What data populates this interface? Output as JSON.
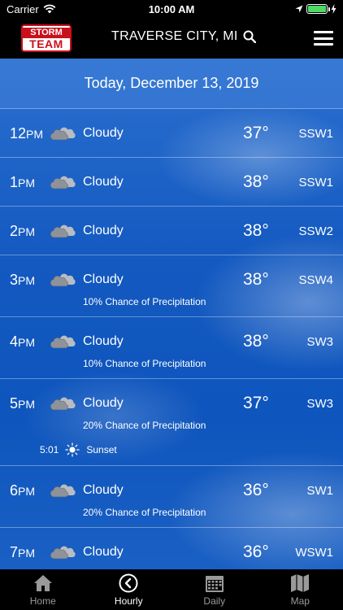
{
  "status": {
    "carrier": "Carrier",
    "time": "10:00 AM"
  },
  "header": {
    "logo_line1": "STORM",
    "logo_line2": "TEAM",
    "location": "TRAVERSE CITY, MI"
  },
  "date": "Today, December 13, 2019",
  "rows": [
    {
      "hour": "12",
      "ampm": "PM",
      "condition": "Cloudy",
      "temp": "37°",
      "wind": "SSW1"
    },
    {
      "hour": "1",
      "ampm": "PM",
      "condition": "Cloudy",
      "temp": "38°",
      "wind": "SSW1"
    },
    {
      "hour": "2",
      "ampm": "PM",
      "condition": "Cloudy",
      "temp": "38°",
      "wind": "SSW2"
    },
    {
      "hour": "3",
      "ampm": "PM",
      "condition": "Cloudy",
      "temp": "38°",
      "wind": "SSW4",
      "precip": "10% Chance of Precipitation"
    },
    {
      "hour": "4",
      "ampm": "PM",
      "condition": "Cloudy",
      "temp": "38°",
      "wind": "SW3",
      "precip": "10% Chance of Precipitation"
    },
    {
      "hour": "5",
      "ampm": "PM",
      "condition": "Cloudy",
      "temp": "37°",
      "wind": "SW3",
      "precip": "20% Chance of Precipitation",
      "sun_time": "5:01",
      "sun_label": "Sunset"
    },
    {
      "hour": "6",
      "ampm": "PM",
      "condition": "Cloudy",
      "temp": "36°",
      "wind": "SW1",
      "precip": "20% Chance of Precipitation"
    },
    {
      "hour": "7",
      "ampm": "PM",
      "condition": "Cloudy",
      "temp": "36°",
      "wind": "WSW1"
    }
  ],
  "tabs": [
    {
      "label": "Home",
      "icon": "home-icon"
    },
    {
      "label": "Hourly",
      "icon": "clock-back-icon",
      "active": true
    },
    {
      "label": "Daily",
      "icon": "calendar-icon"
    },
    {
      "label": "Map",
      "icon": "map-icon"
    }
  ],
  "colors": {
    "background": "#1359c0",
    "bar": "#000000",
    "logo_red": "#c9111c",
    "tab_inactive": "#9a9a9a"
  }
}
